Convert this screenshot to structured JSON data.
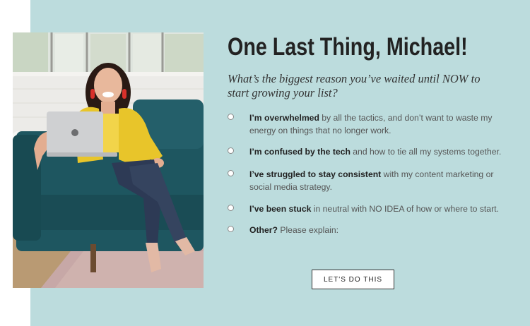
{
  "header": {
    "title": "One Last Thing, Michael!"
  },
  "question": "What’s the biggest reason you’ve waited until NOW to start growing your list?",
  "options": [
    {
      "bold": "I’m overwhelmed",
      "rest": " by all the tactics, and don’t want to waste my energy on things that no longer work."
    },
    {
      "bold": "I’m confused by the tech",
      "rest": " and how to tie all my systems together."
    },
    {
      "bold": "I’ve struggled to stay consistent",
      "rest": " with my content marketing or social media strategy."
    },
    {
      "bold": "I’ve been stuck",
      "rest": " in neutral with NO IDEA of how or where to start."
    },
    {
      "bold": "Other?",
      "rest": " Please explain:"
    }
  ],
  "cta": {
    "label": "LET'S DO THIS"
  },
  "colors": {
    "panel": "#bcdcdd",
    "sofa": "#1e5660",
    "blazer": "#e8c52a"
  }
}
